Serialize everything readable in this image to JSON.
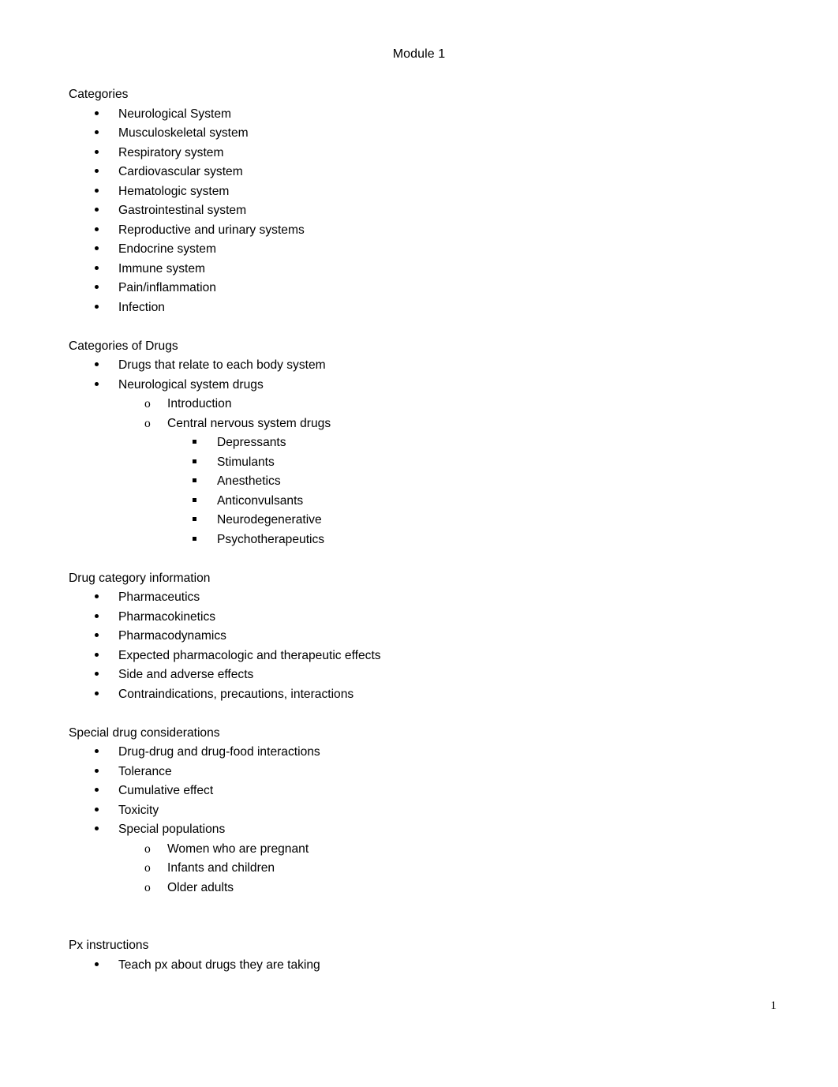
{
  "document": {
    "header": "Module 1",
    "page_number": "1",
    "text_color": "#000000",
    "background_color": "#ffffff"
  },
  "sections": [
    {
      "heading": "Categories",
      "items": [
        {
          "level": 1,
          "text": "Neurological System"
        },
        {
          "level": 1,
          "text": "Musculoskeletal system"
        },
        {
          "level": 1,
          "text": "Respiratory system"
        },
        {
          "level": 1,
          "text": "Cardiovascular system"
        },
        {
          "level": 1,
          "text": "Hematologic system"
        },
        {
          "level": 1,
          "text": "Gastrointestinal system"
        },
        {
          "level": 1,
          "text": "Reproductive and urinary systems"
        },
        {
          "level": 1,
          "text": "Endocrine system"
        },
        {
          "level": 1,
          "text": "Immune system"
        },
        {
          "level": 1,
          "text": "Pain/inflammation"
        },
        {
          "level": 1,
          "text": "Infection"
        }
      ]
    },
    {
      "heading": "Categories of Drugs",
      "items": [
        {
          "level": 1,
          "text": "Drugs that relate to each body system"
        },
        {
          "level": 1,
          "text": "Neurological system drugs"
        },
        {
          "level": 2,
          "text": "Introduction"
        },
        {
          "level": 2,
          "text": "Central nervous system drugs"
        },
        {
          "level": 3,
          "text": "Depressants"
        },
        {
          "level": 3,
          "text": "Stimulants"
        },
        {
          "level": 3,
          "text": "Anesthetics"
        },
        {
          "level": 3,
          "text": "Anticonvulsants"
        },
        {
          "level": 3,
          "text": "Neurodegenerative"
        },
        {
          "level": 3,
          "text": "Psychotherapeutics"
        }
      ]
    },
    {
      "heading": "Drug category information",
      "items": [
        {
          "level": 1,
          "text": "Pharmaceutics"
        },
        {
          "level": 1,
          "text": "Pharmacokinetics"
        },
        {
          "level": 1,
          "text": "Pharmacodynamics"
        },
        {
          "level": 1,
          "text": "Expected pharmacologic and therapeutic effects"
        },
        {
          "level": 1,
          "text": "Side and adverse effects"
        },
        {
          "level": 1,
          "text": "Contraindications, precautions, interactions"
        }
      ]
    },
    {
      "heading": "Special drug considerations",
      "items": [
        {
          "level": 1,
          "text": "Drug-drug and drug-food interactions"
        },
        {
          "level": 1,
          "text": "Tolerance"
        },
        {
          "level": 1,
          "text": "Cumulative effect"
        },
        {
          "level": 1,
          "text": "Toxicity"
        },
        {
          "level": 1,
          "text": "Special populations"
        },
        {
          "level": 2,
          "text": "Women who are pregnant"
        },
        {
          "level": 2,
          "text": "Infants and children"
        },
        {
          "level": 2,
          "text": "Older adults"
        }
      ]
    },
    {
      "heading": "Px instructions",
      "extra_gap": true,
      "items": [
        {
          "level": 1,
          "text": "Teach px about drugs they are taking"
        }
      ]
    }
  ],
  "markers": {
    "level1": "bullet-dot",
    "level2": "o",
    "level3": "bullet-square"
  }
}
